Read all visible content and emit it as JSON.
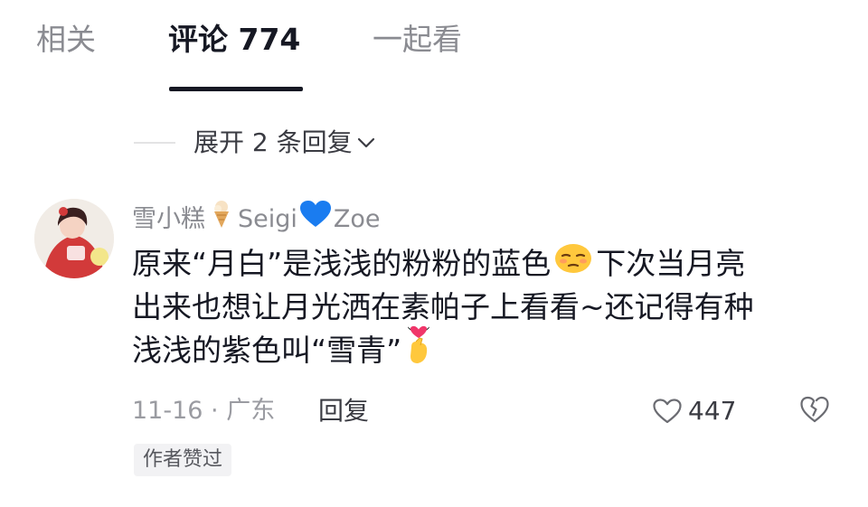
{
  "tabs": {
    "related": "相关",
    "comments": "评论 774",
    "together": "一起看"
  },
  "expand_replies": "展开 2 条回复",
  "comment": {
    "username": "雪小糕",
    "username_suffix_a": "Seigi",
    "username_suffix_b": "Zoe",
    "text_line1_a": "原来“月白”是浅浅的粉粉的蓝色",
    "text_line1_b": "下次当月亮",
    "text_line2": "出来也想让月光洒在素帕子上看看~还记得有种",
    "text_line3": "浅浅的紫色叫“雪青”",
    "date_location": "11-16 · 广东",
    "reply_label": "回复",
    "like_count": "447",
    "author_liked_tag": "作者赞过"
  },
  "icons": {
    "ice_cream": "ice-cream-icon",
    "blue_heart": "blue-heart-icon",
    "emoji_smug": "smug-face-emoji",
    "emoji_heart_hand": "finger-heart-emoji",
    "like": "heart-outline-icon",
    "dislike": "broken-heart-icon",
    "chevron": "chevron-down-icon"
  },
  "colors": {
    "text_primary": "#161823",
    "text_secondary": "#8a8b91",
    "blue_heart": "#1a7cf0"
  }
}
